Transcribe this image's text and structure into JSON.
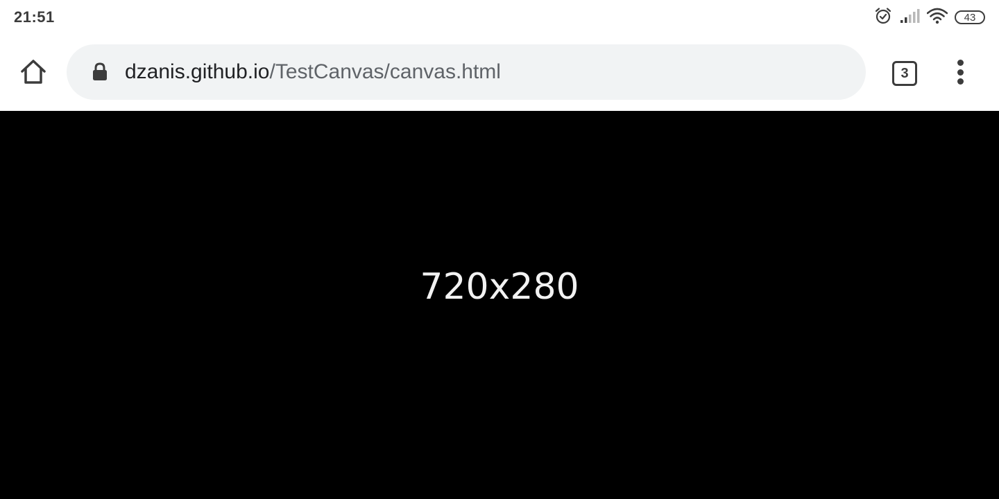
{
  "status_bar": {
    "time": "21:51",
    "battery_level": "43",
    "icons": [
      "alarm-icon",
      "signal-icon",
      "wifi-icon",
      "battery-icon"
    ]
  },
  "toolbar": {
    "home_icon": "home-icon",
    "lock_icon": "lock-icon",
    "url_host": "dzanis.github.io",
    "url_path": "/TestCanvas/canvas.html",
    "tab_count": "3",
    "menu_icon": "more-vert-icon"
  },
  "page": {
    "canvas_text": "720x280"
  },
  "colors": {
    "toolbar_bg": "#ffffff",
    "omnibox_bg": "#f1f3f4",
    "icon": "#3c3c3c",
    "canvas_bg": "#000000",
    "canvas_text": "#f2f2f2"
  }
}
